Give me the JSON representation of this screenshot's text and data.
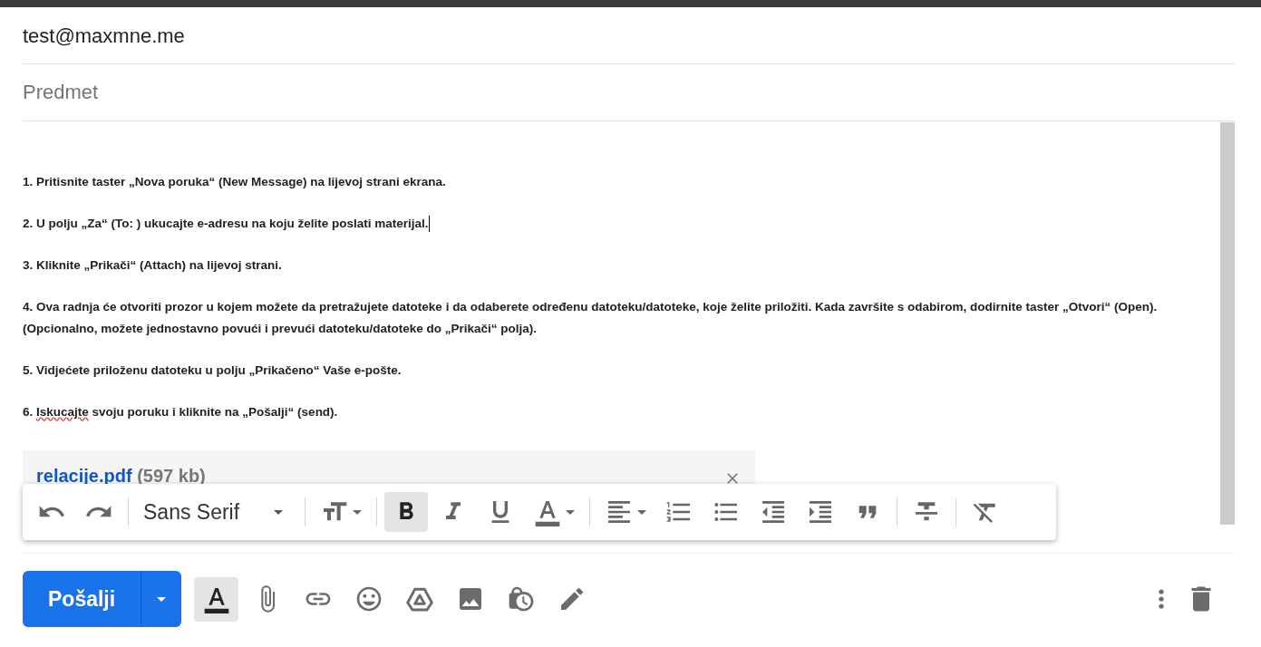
{
  "to": {
    "value": "test@maxmne.me"
  },
  "subject": {
    "placeholder": "Predmet"
  },
  "body": {
    "paragraphs": [
      {
        "segments": [
          {
            "text": "1. Pritisnite taster „Nova poruka“ (New Message) na lijevoj strani ekrana.",
            "misspelled": false
          }
        ],
        "caret": false
      },
      {
        "segments": [
          {
            "text": "2. U polju „Za“ (To: ) ukucajte e-adresu na koju želite poslati materijal.",
            "misspelled": false
          }
        ],
        "caret": true
      },
      {
        "segments": [
          {
            "text": "3. Kliknite „Prikači“ (Attach) na lijevoj strani.",
            "misspelled": false
          }
        ],
        "caret": false
      },
      {
        "segments": [
          {
            "text": "4. Ova radnja će otvoriti prozor u kojem možete da pretražujete datoteke i da odaberete određenu datoteku/datoteke, koje želite priložiti. Kada završite s odabirom, dodirnite taster „Otvori“ (Open). (Opcionalno, možete jednostavno povući i prevući datoteku/datoteke do „Prikači“ polja).",
            "misspelled": false
          }
        ],
        "caret": false
      },
      {
        "segments": [
          {
            "text": "5. Vidjećete priloženu datoteku u polju „Prikačeno“ Vaše e-pošte.",
            "misspelled": false
          }
        ],
        "caret": false
      },
      {
        "segments": [
          {
            "text": "6. ",
            "misspelled": false
          },
          {
            "text": "Iskucajte",
            "misspelled": true
          },
          {
            "text": " svoju poruku i kliknite na „Pošalji“ (send).",
            "misspelled": false
          }
        ],
        "caret": false
      }
    ]
  },
  "attachment": {
    "name": "relacije.pdf",
    "size": "(597 kb)"
  },
  "format_toolbar": {
    "items": [
      {
        "kind": "undo"
      },
      {
        "kind": "redo"
      },
      {
        "kind": "separator"
      },
      {
        "kind": "font",
        "label": "Sans Serif"
      },
      {
        "kind": "separator"
      },
      {
        "kind": "size"
      },
      {
        "kind": "separator"
      },
      {
        "kind": "bold",
        "on": true
      },
      {
        "kind": "italic",
        "on": false
      },
      {
        "kind": "underline",
        "on": false
      },
      {
        "kind": "color"
      },
      {
        "kind": "separator"
      },
      {
        "kind": "align"
      },
      {
        "kind": "numbered"
      },
      {
        "kind": "bulleted"
      },
      {
        "kind": "outdent"
      },
      {
        "kind": "indent"
      },
      {
        "kind": "quote"
      },
      {
        "kind": "separator"
      },
      {
        "kind": "strike",
        "on": false
      },
      {
        "kind": "separator"
      },
      {
        "kind": "clear"
      }
    ]
  },
  "send_button": {
    "label": "Pošalji"
  },
  "bottom_toolbar": {
    "items": [
      {
        "kind": "formatting",
        "on": true
      },
      {
        "kind": "attach"
      },
      {
        "kind": "link"
      },
      {
        "kind": "emoji"
      },
      {
        "kind": "drive"
      },
      {
        "kind": "photo"
      },
      {
        "kind": "confidential"
      },
      {
        "kind": "signature"
      }
    ]
  }
}
